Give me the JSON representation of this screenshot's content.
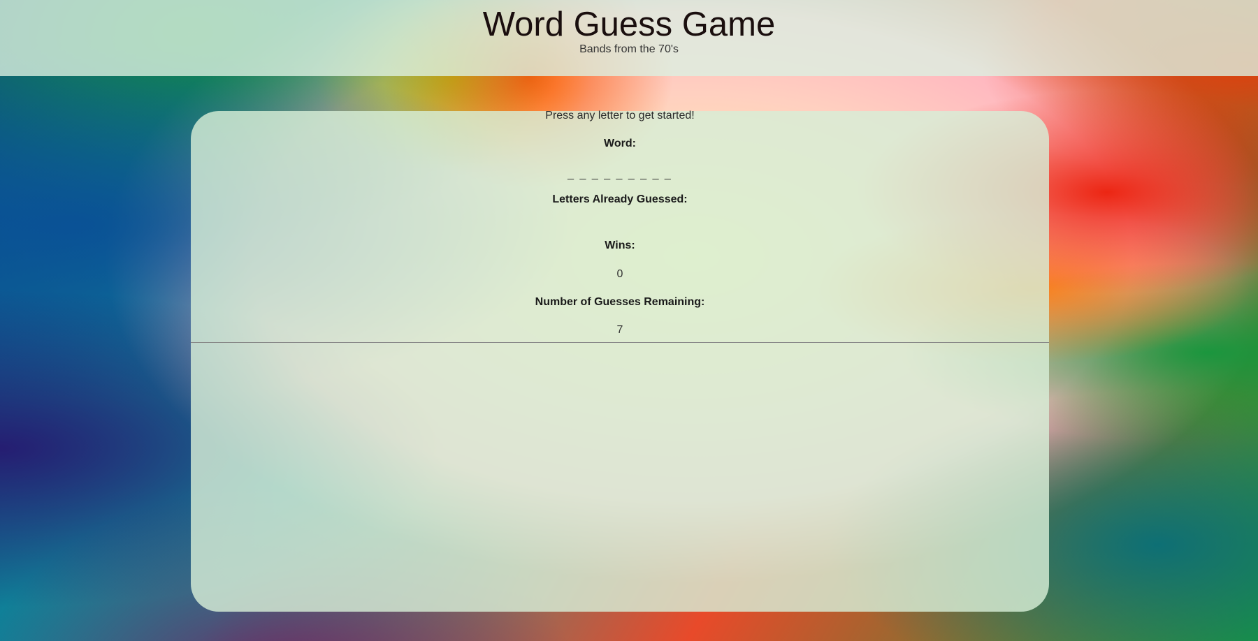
{
  "header": {
    "title": "Word Guess Game",
    "subtitle": "Bands from the 70's"
  },
  "game": {
    "instructions": "Press any letter to get started!",
    "word_label": "Word:",
    "word_value": "_ _ _ _ _ _ _ _ _",
    "guessed_label": "Letters Already Guessed:",
    "guessed_value": "",
    "wins_label": "Wins:",
    "wins_value": "0",
    "remaining_label": "Number of Guesses Remaining:",
    "remaining_value": "7"
  }
}
